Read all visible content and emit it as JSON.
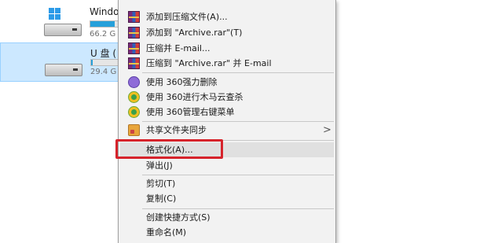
{
  "drives": [
    {
      "name": "Windo",
      "size": "66.2 G",
      "usage_fraction": 0.85,
      "os_drive": true,
      "selected": false
    },
    {
      "name": "U 盘 (",
      "size": "29.4 G",
      "usage_fraction": 0.05,
      "os_drive": false,
      "selected": true
    }
  ],
  "menu": {
    "items": [
      {
        "label": "添加到压缩文件(A)...",
        "icon": "winrar-icon"
      },
      {
        "label": "添加到 \"Archive.rar\"(T)",
        "icon": "winrar-icon"
      },
      {
        "label": "压缩并 E-mail...",
        "icon": "winrar-icon"
      },
      {
        "label": "压缩到 \"Archive.rar\" 并 E-mail",
        "icon": "winrar-icon"
      },
      {
        "label": "使用 360强力删除",
        "icon": "360-shred-icon"
      },
      {
        "label": "使用 360进行木马云查杀",
        "icon": "360-scan-icon"
      },
      {
        "label": "使用 360管理右键菜单",
        "icon": "360-manage-icon"
      },
      {
        "label": "共享文件夹同步",
        "icon": "share-sync-icon",
        "submenu_arrow": ">"
      },
      {
        "label": "格式化(A)...",
        "highlighted": true
      },
      {
        "label": "弹出(J)"
      },
      {
        "label": "剪切(T)"
      },
      {
        "label": "复制(C)"
      },
      {
        "label": "创建快捷方式(S)"
      },
      {
        "label": "重命名(M)"
      }
    ]
  },
  "colors": {
    "highlight_box": "#d6232b",
    "selection": "#cce8ff",
    "menu_bg": "#f2f2f2"
  }
}
